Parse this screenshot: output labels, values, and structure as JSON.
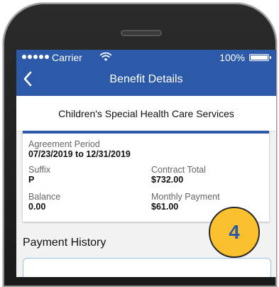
{
  "status_bar": {
    "carrier": "Carrier",
    "battery_percent": "100%"
  },
  "nav": {
    "title": "Benefit Details",
    "back_icon": "chevron-left-icon"
  },
  "program_name": "Children's Special Health Care Services",
  "details": {
    "agreement_period_label": "Agreement Period",
    "agreement_period_value": "07/23/2019 to 12/31/2019",
    "suffix_label": "Suffix",
    "suffix_value": "P",
    "contract_total_label": "Contract Total",
    "contract_total_value": "$732.00",
    "balance_label": "Balance",
    "balance_value": "0.00",
    "monthly_payment_label": "Monthly Payment",
    "monthly_payment_value": "$61.00"
  },
  "payment_history": {
    "title": "Payment History"
  },
  "callout_badge": "4",
  "colors": {
    "brand_blue": "#2c5aa8",
    "badge_yellow": "#fbc02d"
  }
}
